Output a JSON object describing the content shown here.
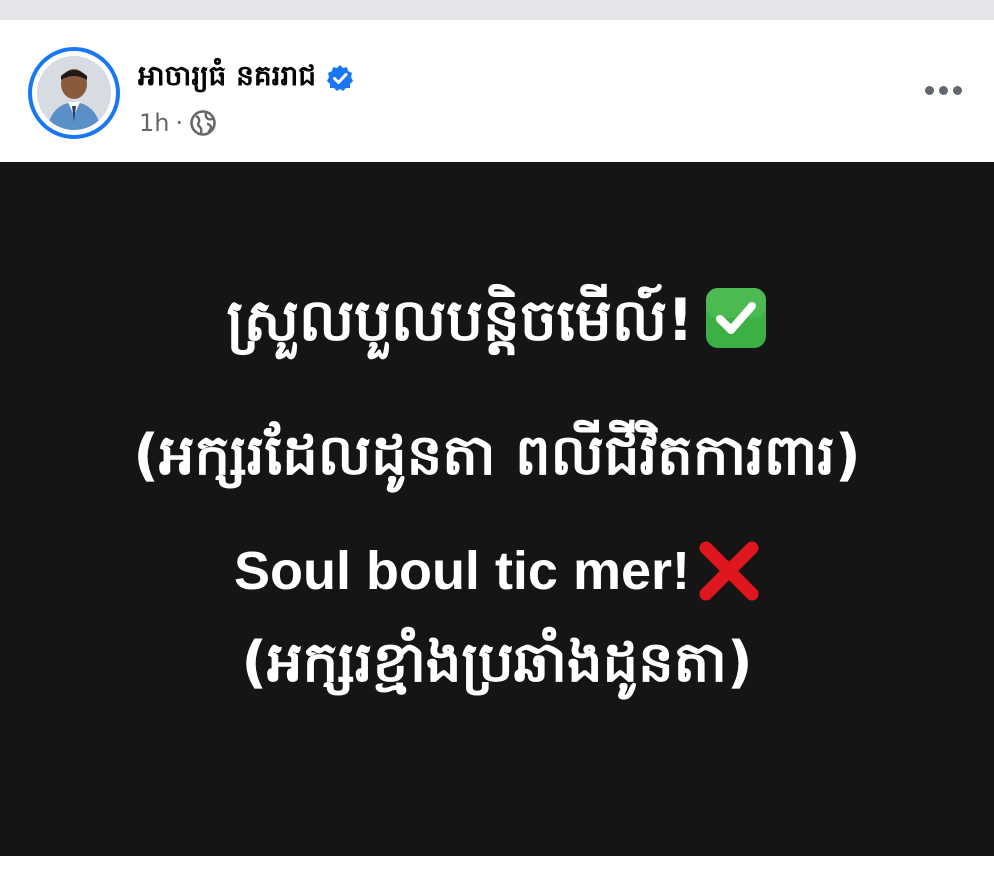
{
  "post": {
    "author": "អាចារ្យធំ នគររាជ",
    "time": "1h",
    "separator": "·",
    "verified_icon": "verified-badge-icon",
    "audience_icon": "globe-icon",
    "more_icon": "more-options-icon",
    "accent_color": "#1877f2"
  },
  "image": {
    "line1": "ស្រួលបួលបន្តិចមើល៍!",
    "line2": "(អក្សរដែលដូនតា ពលីជីវិតការពារ)",
    "line3": "Soul boul tic mer!",
    "line4": "(អក្សរខ្មាំងប្រឆាំងដូនតា)",
    "check_icon": "green-check-icon",
    "cross_icon": "red-cross-icon",
    "background_color": "#151515"
  }
}
